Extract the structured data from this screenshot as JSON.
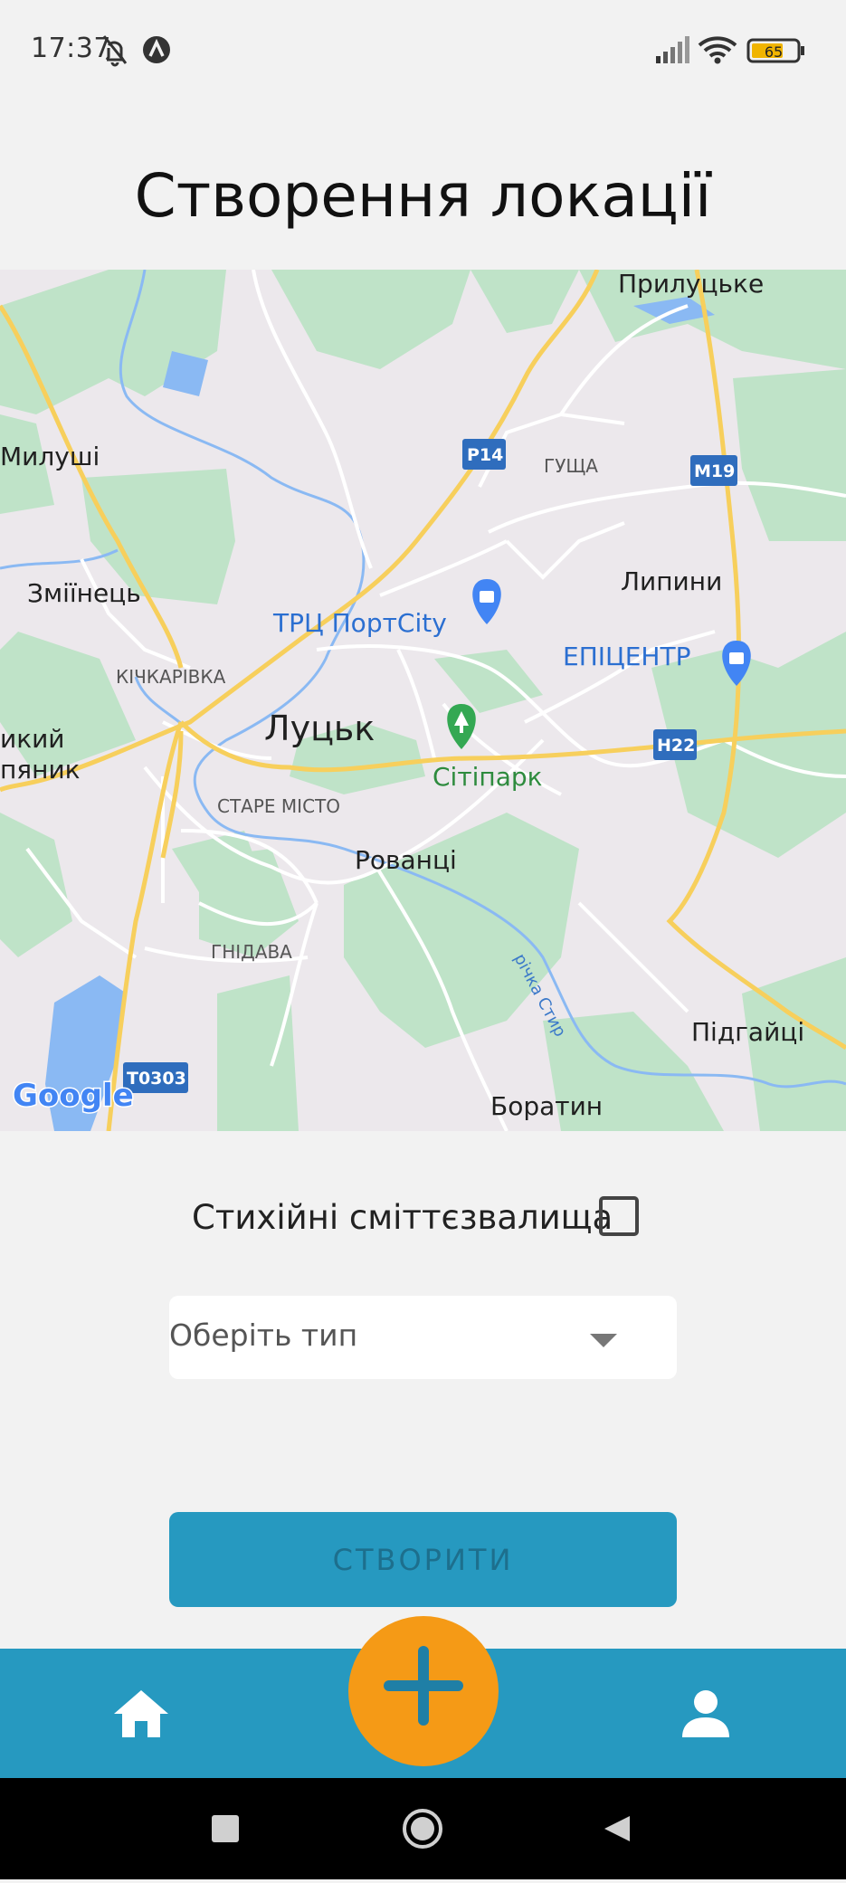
{
  "status_bar": {
    "time": "17:37",
    "battery": "65",
    "icons": [
      "bell-off-icon",
      "app-notification-icon",
      "signal-icon",
      "wifi-icon",
      "battery-icon"
    ]
  },
  "page": {
    "title": "Створення локації"
  },
  "map": {
    "labels": {
      "pryluts_ke": "Прилуцьке",
      "mylushi": "Милуші",
      "p14": "Р14",
      "hushcha": "ГУЩА",
      "m19": "М19",
      "zmiinets": "Змiїнець",
      "lypyny": "Липини",
      "trc_portcity": "ТРЦ ПортCity",
      "epicentr": "ЕПІЦЕНТР",
      "kichkarivka": "КІЧКАРІВКА",
      "lutsk": "Луцьк",
      "vykyi": "икий",
      "pianyk": "пяник",
      "citypark": "Сітіпарк",
      "h22": "Н22",
      "stare_misto": "СТАРЕ МІСТО",
      "rovantsi": "Рованці",
      "hnidava": "ГНІДАВА",
      "river_styr": "річка Стир",
      "pidhaitsi": "Підгайці",
      "t0303": "Т0303",
      "boratyn": "Боратин",
      "google": "Google"
    },
    "colors": {
      "land": "#ece8ec",
      "green": "#bfe3c8",
      "water": "#8ab9f3",
      "road": "#ffffff",
      "highway": "#f7cf5c",
      "shield": "#2f6dbd",
      "poi_blue": "#4285f4",
      "poi_green": "#34a853"
    }
  },
  "form": {
    "checkbox_label": "Стихійні сміттєзвалища",
    "checkbox_checked": false,
    "select_placeholder": "Оберіть тип",
    "create_button_label": "СТВОРИТИ"
  },
  "bottom_nav": {
    "items": [
      "home-icon",
      "add-icon",
      "profile-icon"
    ],
    "colors": {
      "bar": "#2699c0",
      "fab": "#f59a16"
    }
  },
  "system_nav": {
    "items": [
      "recent-apps-icon",
      "home-circle-icon",
      "back-icon"
    ]
  }
}
